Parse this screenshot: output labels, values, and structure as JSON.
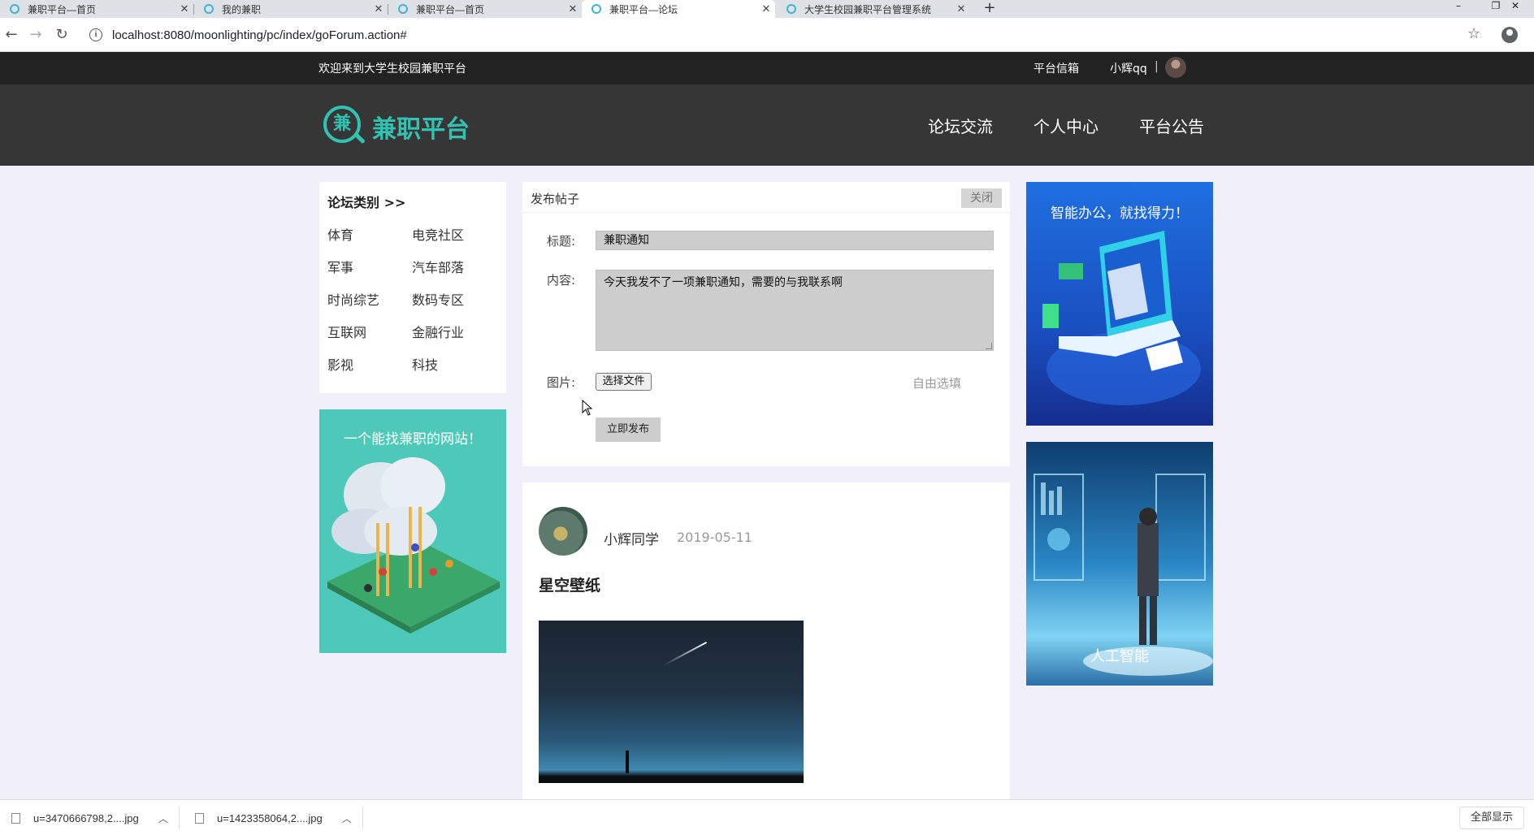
{
  "browser": {
    "tabs": [
      {
        "title": "兼职平台—首页",
        "active": false
      },
      {
        "title": "我的兼职",
        "active": false
      },
      {
        "title": "兼职平台—首页",
        "active": false
      },
      {
        "title": "兼职平台—论坛",
        "active": true
      },
      {
        "title": "大学生校园兼职平台管理系统",
        "active": false
      }
    ],
    "close_glyph": "✕",
    "newtab_glyph": "+",
    "url": "localhost:8080/moonlighting/pc/index/goForum.action#"
  },
  "topbar": {
    "welcome": "欢迎来到大学生校园兼职平台",
    "mailbox": "平台信箱",
    "username": "小辉qq",
    "separator": "|"
  },
  "header": {
    "logo_char": "兼",
    "logo_text": "兼职平台",
    "nav": [
      "论坛交流",
      "个人中心",
      "平台公告"
    ]
  },
  "categories": {
    "title": "论坛类别 >>",
    "items": [
      "体育",
      "电竞社区",
      "军事",
      "汽车部落",
      "时尚综艺",
      "数码专区",
      "互联网",
      "金融行业",
      "影视",
      "科技"
    ]
  },
  "promo_left": {
    "text": "一个能找兼职的网站！"
  },
  "post_form": {
    "heading": "发布帖子",
    "close_label": "关闭",
    "title_label": "标题:",
    "title_value": "兼职通知",
    "content_label": "内容:",
    "content_value": "今天我发不了一项兼职通知，需要的与我联系啊",
    "image_label": "图片:",
    "file_button": "选择文件",
    "optional_note": "自由选填",
    "submit_label": "立即发布"
  },
  "post": {
    "author": "小辉同学",
    "date": "2019-05-11",
    "title": "星空壁纸"
  },
  "ads": {
    "ad1_text": "智能办公，就找得力！",
    "ad2_text": "人工智能"
  },
  "downloads": {
    "items": [
      "u=3470666798,2....jpg",
      "u=1423358064,2....jpg"
    ],
    "show_all": "全部显示"
  },
  "colors": {
    "brand_teal": "#32c2b2",
    "page_bg": "#f0effa",
    "header_bg": "#363636",
    "topstrip_bg": "#222222"
  }
}
